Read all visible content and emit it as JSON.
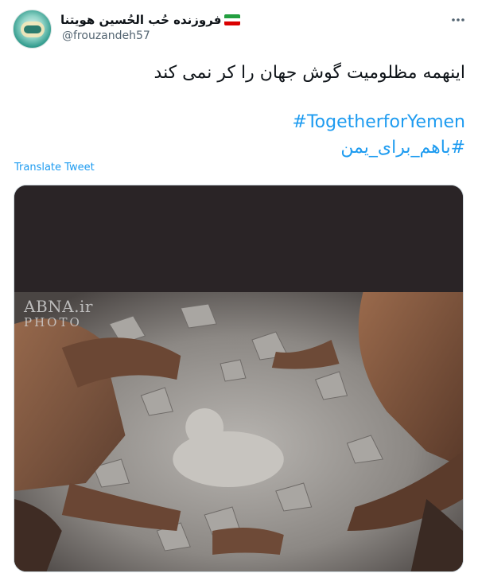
{
  "tweet": {
    "display_name": "فروزنده حُب الحُسین هویتنا",
    "handle": "@frouzandeh57",
    "text": "اینهمه مظلومیت گوش جهان را کر نمی کند",
    "hashtags": [
      "#TogetherforYemen",
      "#باهم_برای_یمن"
    ],
    "translate_label": "Translate Tweet",
    "more_icon": "more-horizontal-icon",
    "flag_colors": [
      "#239f40",
      "#ffffff",
      "#da0000"
    ],
    "link_color": "#1d9bf0"
  },
  "media": {
    "watermark_line1": "ABNA.ir",
    "watermark_line2": "PHOTO"
  }
}
